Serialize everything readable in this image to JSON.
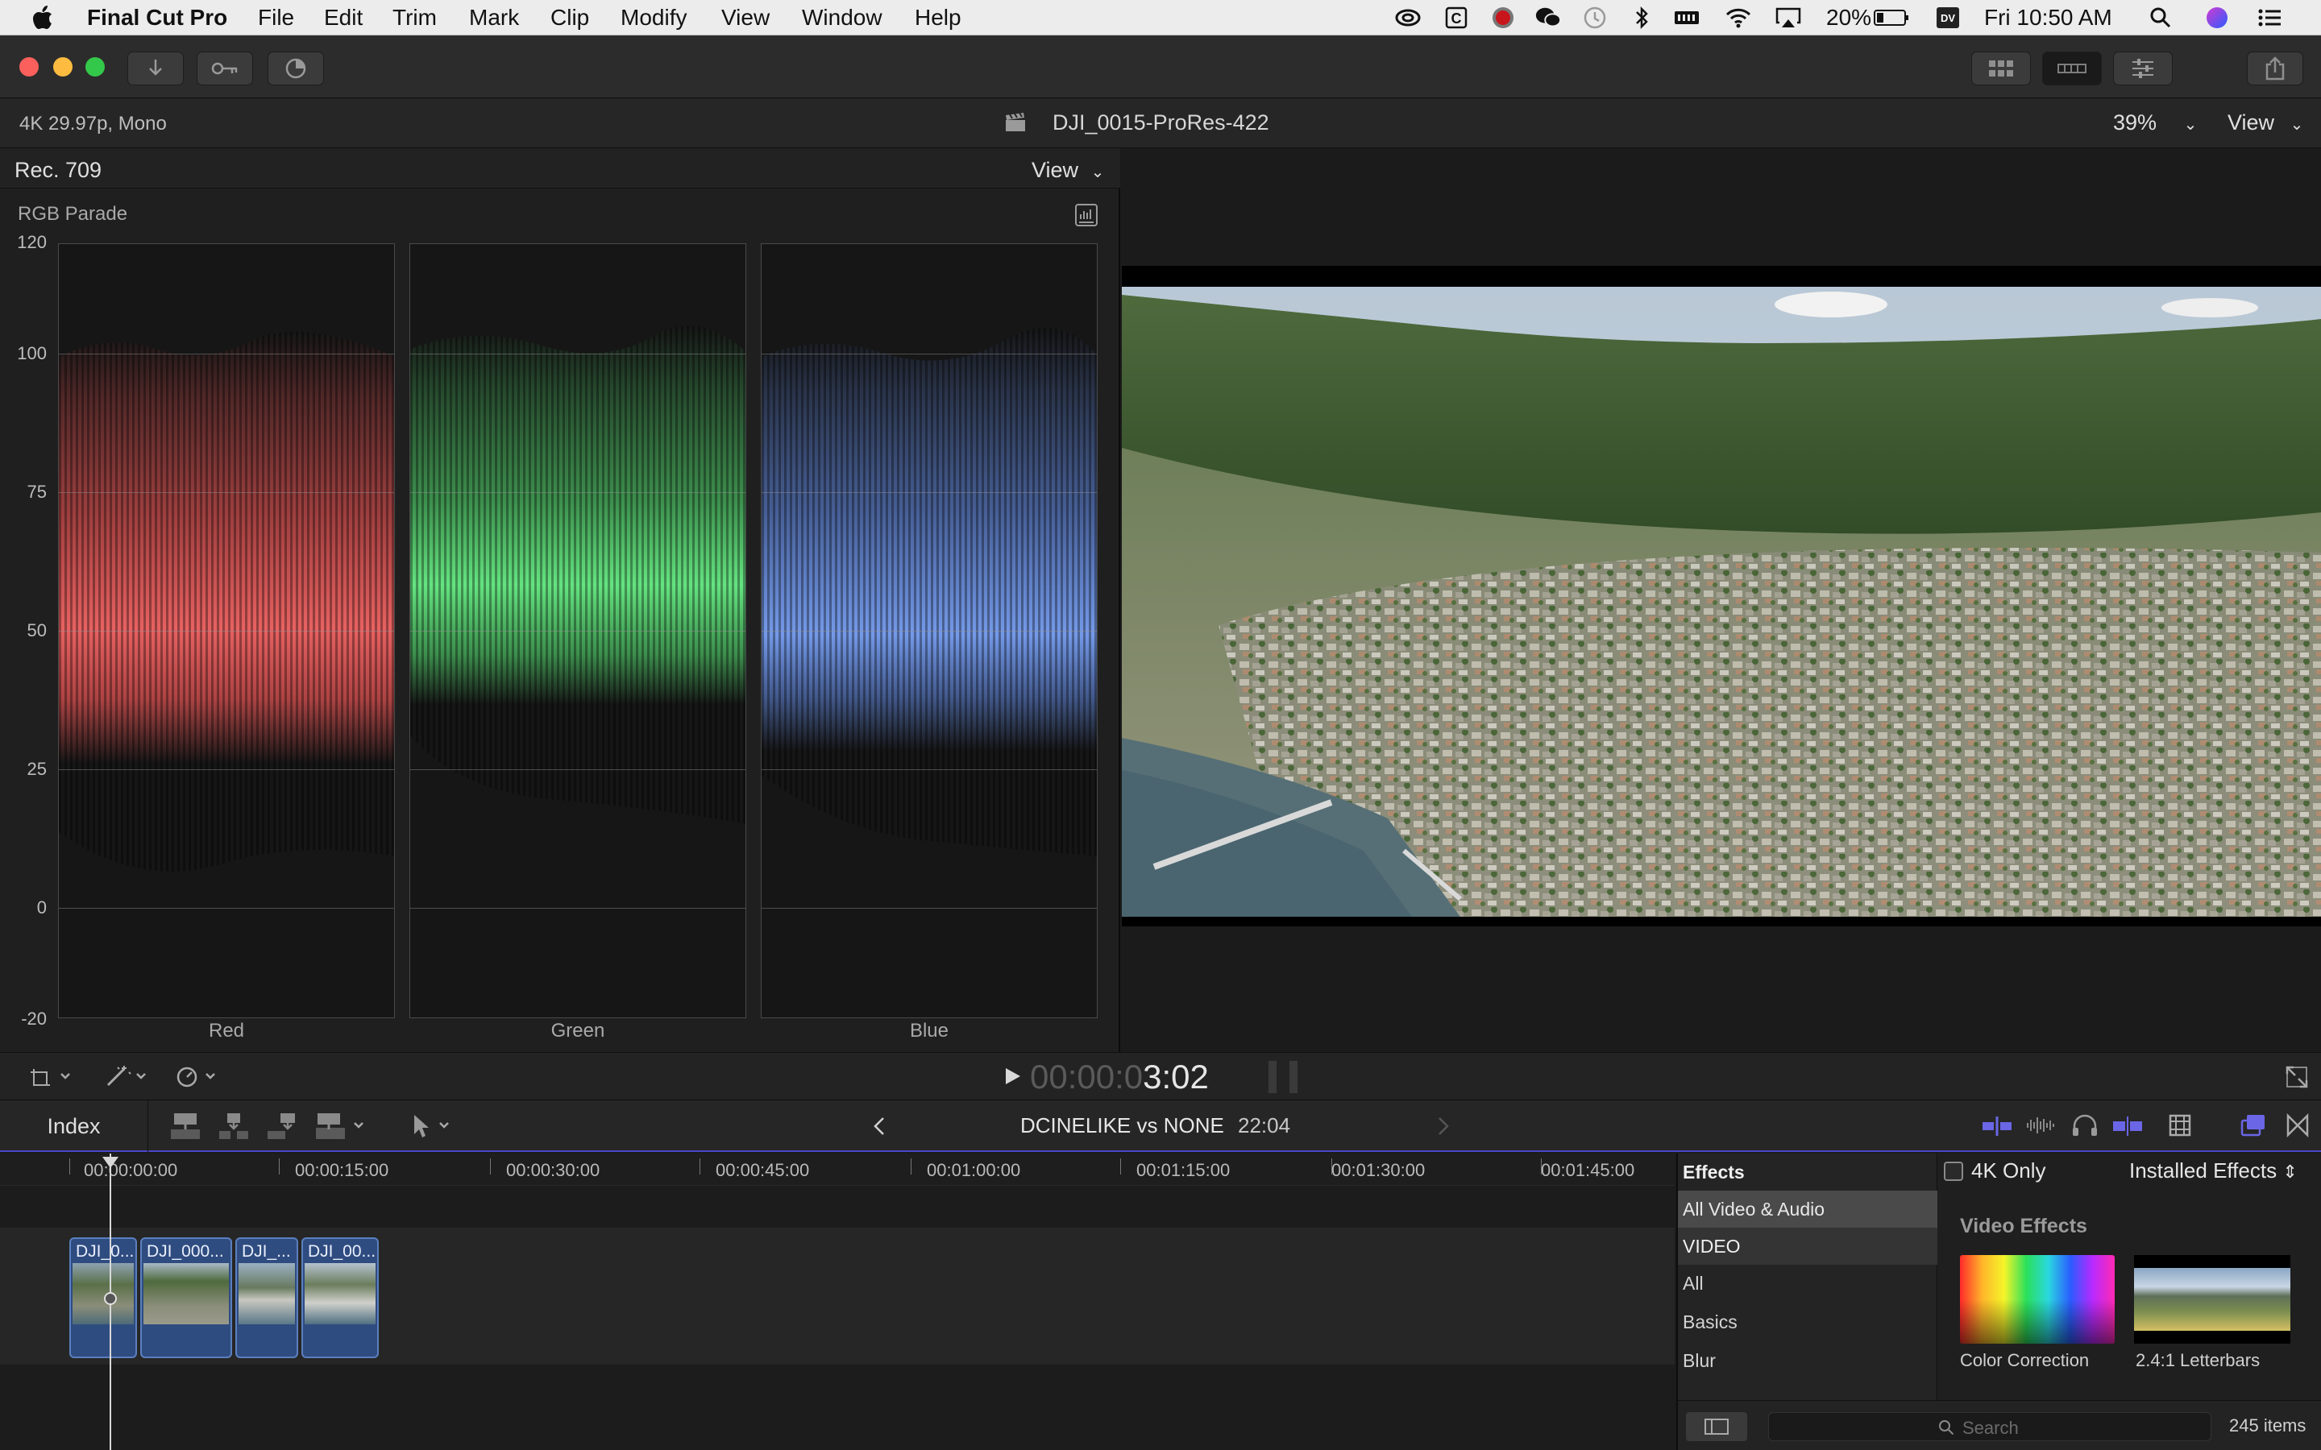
{
  "menubar": {
    "app_name": "Final Cut Pro",
    "items": [
      "File",
      "Edit",
      "Trim",
      "Mark",
      "Clip",
      "Modify",
      "View",
      "Window",
      "Help"
    ],
    "battery": "20%",
    "clock": "Fri 10:50 AM",
    "dv_badge": "DV"
  },
  "infobar": {
    "format": "4K 29.97p, Mono",
    "clip_name": "DJI_0015-ProRes-422",
    "zoom": "39%",
    "view_label": "View"
  },
  "scope": {
    "color_space": "Rec. 709",
    "view_label": "View",
    "title": "RGB Parade",
    "y_labels": [
      "120",
      "100",
      "75",
      "50",
      "25",
      "0",
      "-20"
    ],
    "channels": [
      "Red",
      "Green",
      "Blue"
    ]
  },
  "viewer_controls": {
    "timecode_dim": "00:00:0",
    "timecode_bright": "3:02"
  },
  "timeline_header": {
    "index_label": "Index",
    "project_name": "DCINELIKE vs NONE",
    "duration": "22:04"
  },
  "timeline": {
    "ruler": [
      "00:00:00:00",
      "00:00:15:00",
      "00:00:30:00",
      "00:00:45:00",
      "00:01:00:00",
      "00:01:15:00",
      "00:01:30:00",
      "00:01:45:00"
    ],
    "clips": [
      "DJI_0...",
      "DJI_000...",
      "DJI_...",
      "DJI_00..."
    ]
  },
  "effects": {
    "tab_label": "Effects",
    "categories": [
      "All Video & Audio",
      "VIDEO",
      "All",
      "Basics",
      "Blur"
    ],
    "filter_label": "4K Only",
    "source_label": "Installed Effects",
    "section_title": "Video Effects",
    "items": [
      "Color Correction",
      "2.4:1 Letterbars"
    ],
    "search_placeholder": "Search",
    "count": "245 items"
  },
  "colors": {
    "accent": "#4b46c8",
    "red_trace": "#ff5c5c",
    "green_trace": "#5cf07a",
    "blue_trace": "#6f9bff",
    "clip_blue": "#2f4c80"
  }
}
